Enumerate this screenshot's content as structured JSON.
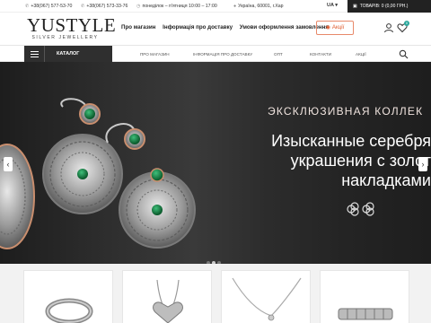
{
  "topbar": {
    "phone1": "+38(067) 577-53-70",
    "phone2": "+38(067) 573-33-76",
    "hours": "понеділок – п'ятниця 10:00 – 17:00",
    "address": "Україна, 60001, г.Хар",
    "lang": "UA",
    "cart": "ТОВАРІВ: 0 (0,00 ГРН.)"
  },
  "logo": {
    "main": "YUSTYLE",
    "sub": "SILVER JEWELLERY"
  },
  "mainnav": [
    "Про магазин",
    "Інформація про доставку",
    "Умови оформлення замовлення"
  ],
  "promo": {
    "label": "Акції"
  },
  "wishlist_count": "0",
  "catalog": {
    "label": "КАТАЛОГ"
  },
  "subnav": [
    "ПРО МАГАЗИН",
    "ІНФОРМАЦІЯ ПРО ДОСТАВКУ",
    "ОПТ",
    "КОНТАКТИ",
    "АКЦІЇ"
  ],
  "hero": {
    "tag": "ЭКСКЛЮЗИВНАЯ КОЛЛЕК",
    "title_lines": [
      "Изысканные серебря",
      "украшения с золот",
      "накладками"
    ],
    "prev": "‹",
    "next": "›"
  },
  "colors": {
    "accent": "#e05a2c",
    "dark": "#2f2f2f",
    "badge": "#2aa79b"
  }
}
